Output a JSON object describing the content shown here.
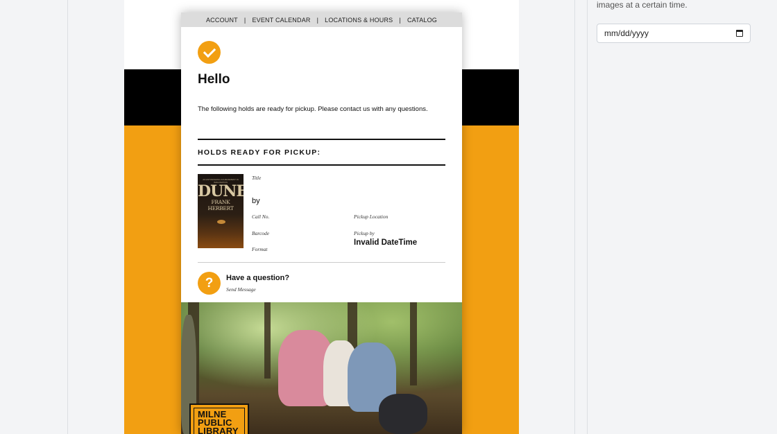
{
  "right_panel": {
    "help_text": "images at a certain time.",
    "date_input": {
      "placeholder": "mm/dd/yyyy"
    }
  },
  "email": {
    "nav": [
      "ACCOUNT",
      "EVENT CALENDAR",
      "LOCATIONS & HOURS",
      "CATALOG"
    ],
    "greeting": "Hello",
    "intro": "The following holds are ready for pickup. Please contact us with any questions.",
    "holds_heading": "HOLDS READY FOR PICKUP:",
    "book": {
      "cover_small_text": "AN ASTONISHING ACHIEVEMENT IN IMAGINATION",
      "cover_title": "DUNE",
      "cover_author": "FRANK HERBERT",
      "title_label": "Title",
      "by_text": "by",
      "call_no_label": "Call No.",
      "pickup_location_label": "Pickup Location",
      "barcode_label": "Barcode",
      "pickup_by_label": "Pickup by",
      "pickup_by_value": "Invalid DateTime",
      "format_label": "Format"
    },
    "question": {
      "heading": "Have a question?",
      "link": "Send Message",
      "icon_glyph": "?"
    },
    "library_logo": [
      "MILNE",
      "PUBLIC",
      "LIBRARY"
    ]
  },
  "colors": {
    "accent": "#f29f12",
    "band": "#000000"
  },
  "icons": [
    "checkmark-icon",
    "question-icon",
    "calendar-icon"
  ]
}
